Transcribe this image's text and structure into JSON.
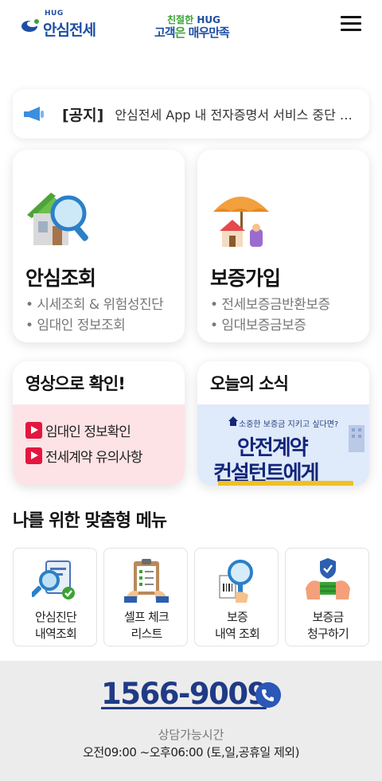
{
  "header": {
    "logo_sup": "HUG",
    "logo_text": "안심전세",
    "slogan_pre": "친절한 ",
    "slogan_hug": "HUG",
    "slogan_b1": "고객",
    "slogan_mid": "은 ",
    "slogan_b2": "매우만족",
    "menu_icon": "hamburger-menu-icon"
  },
  "notice": {
    "tag": "[공지]",
    "text": "안심전세 App 내 전자증명서 서비스 중단 안내",
    "icon": "megaphone-icon"
  },
  "cards": {
    "lookup": {
      "title": "안심조회",
      "items": [
        "• 시세조회 & 위험성진단",
        "• 임대인 정보조회"
      ]
    },
    "guarantee": {
      "title": "보증가입",
      "items": [
        "• 전세보증금반환보증",
        "• 임대보증금보증"
      ]
    },
    "video": {
      "title": "영상으로 확인!",
      "items": [
        "임대인 정보확인",
        "전세계약 유의사항"
      ]
    },
    "news": {
      "title": "오늘의 소식",
      "banner_small": "소중한 보증금 지키고 싶다면?",
      "banner_line1": "안전계약",
      "banner_line2": "컨설턴트에게"
    }
  },
  "custom_menu": {
    "title": "나를 위한 맞춤형 메뉴",
    "items": [
      {
        "label": "안심진단\n내역조회",
        "icon": "diagnosis-report-icon"
      },
      {
        "label": "셀프 체크\n리스트",
        "icon": "clipboard-checklist-icon"
      },
      {
        "label": "보증\n내역 조회",
        "icon": "magnifier-document-icon"
      },
      {
        "label": "보증금\n청구하기",
        "icon": "money-shield-icon"
      }
    ]
  },
  "footer": {
    "phone": "1566-9009",
    "hours_label": "상담가능시간",
    "hours": "오전09:00 ~오후06:00 (토,일,공휴일 제외)"
  },
  "colors": {
    "brand_blue": "#1d4fa3",
    "slogan_green": "#3aa336",
    "video_bg": "#fde3e6",
    "news_bg": "#dfeafb",
    "footer_bg": "#ececec"
  }
}
